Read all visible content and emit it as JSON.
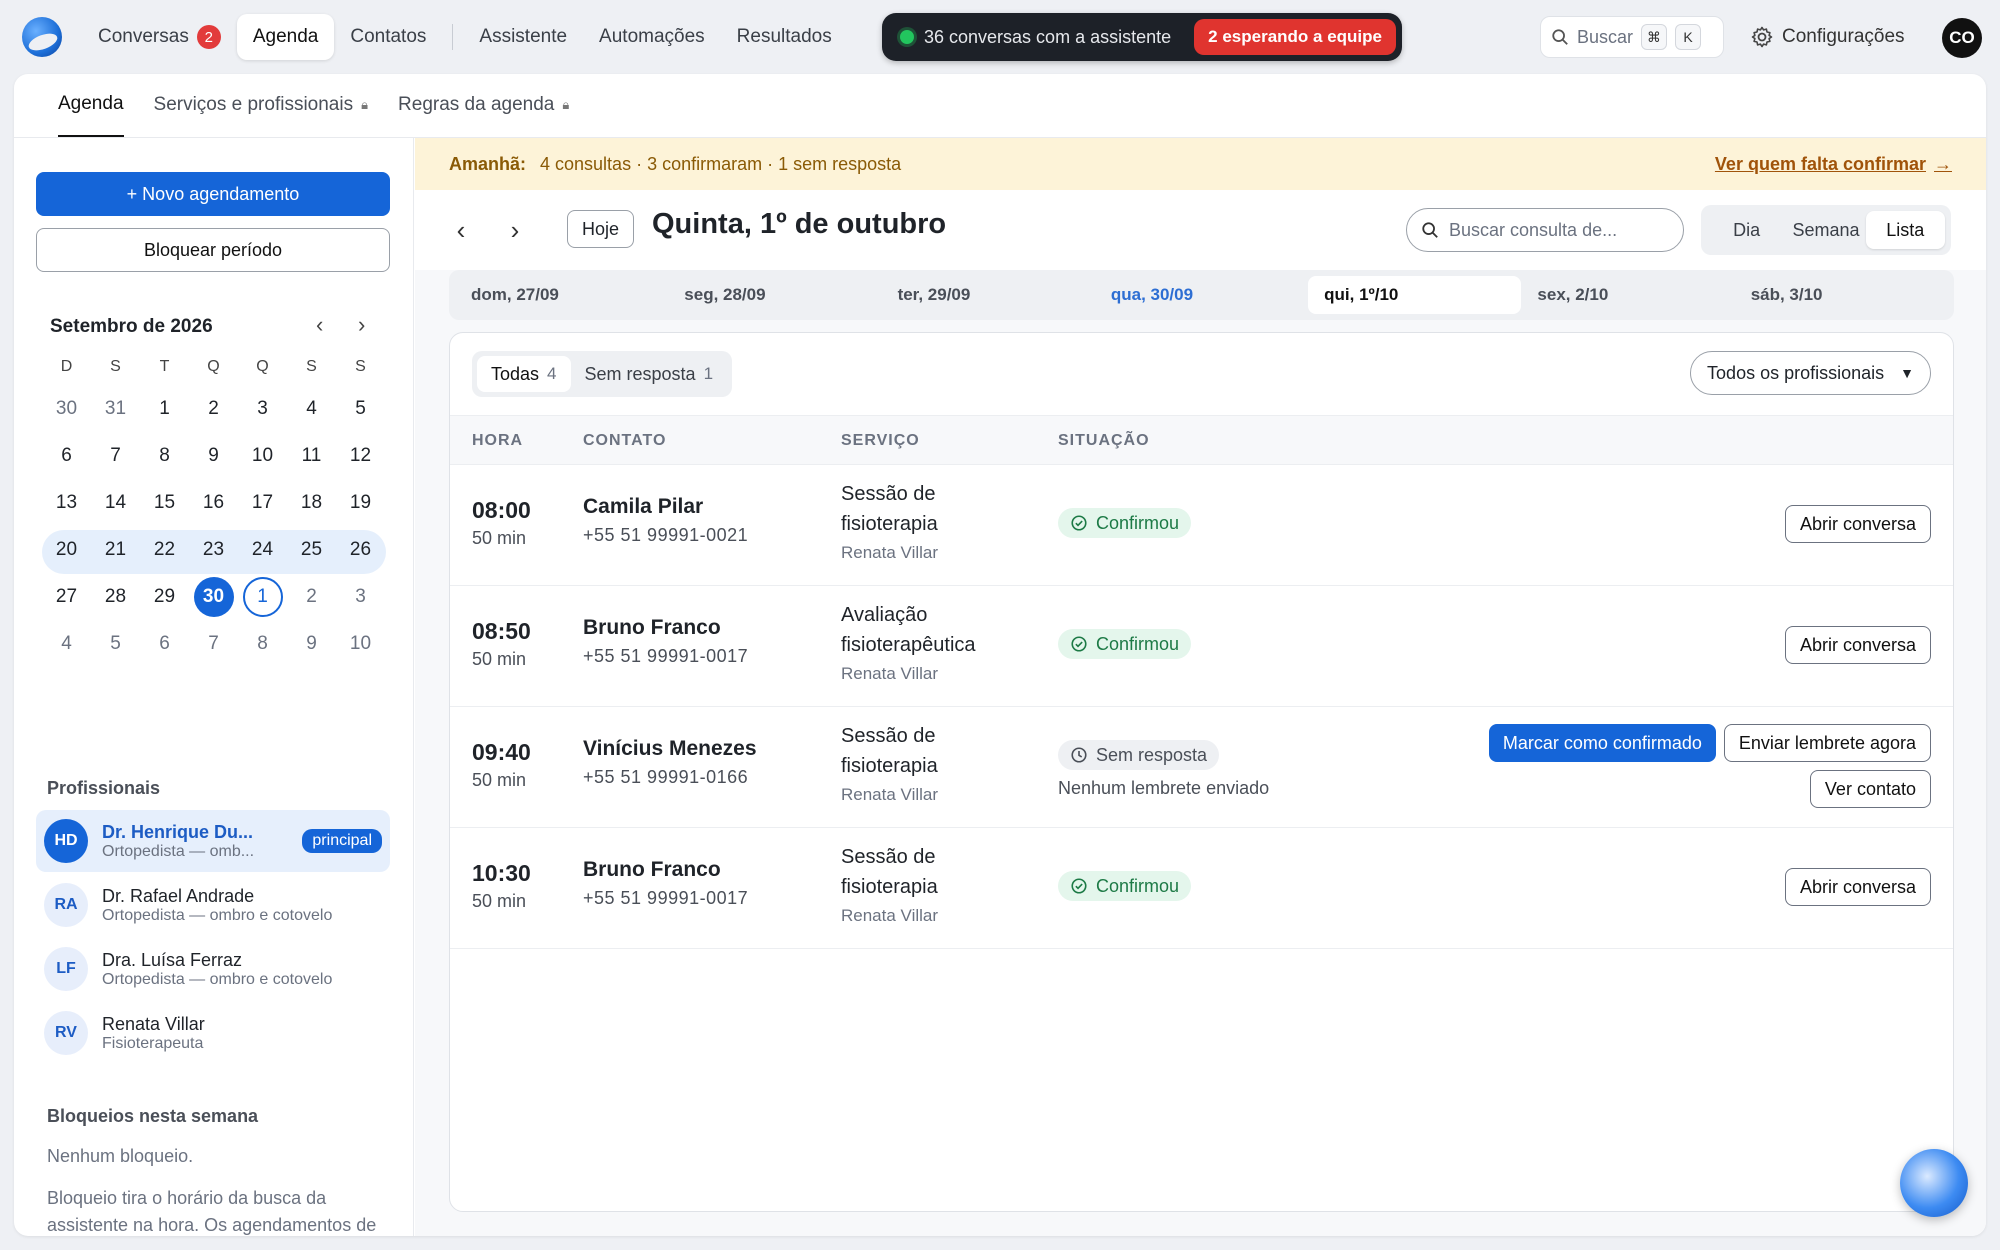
{
  "topnav": {
    "items": [
      {
        "label": "Conversas",
        "badge": "2"
      },
      {
        "label": "Agenda"
      },
      {
        "label": "Contatos"
      },
      {
        "label": "Assistente"
      },
      {
        "label": "Automações"
      },
      {
        "label": "Resultados"
      }
    ],
    "assistant_status": "36 conversas com a assistente",
    "waiting_team": "2 esperando a equipe",
    "search_label": "Buscar",
    "search_kbd": [
      "⌘",
      "K"
    ],
    "settings_label": "Configurações",
    "user_initials": "CO"
  },
  "subtabs": [
    {
      "label": "Agenda"
    },
    {
      "label": "Serviços e profissionais",
      "locked": true
    },
    {
      "label": "Regras da agenda",
      "locked": true
    }
  ],
  "sidebar": {
    "new_appointment": "+ Novo agendamento",
    "block_period": "Bloquear período",
    "calendar": {
      "title": "Setembro de 2026",
      "weekdays": [
        "D",
        "S",
        "T",
        "Q",
        "Q",
        "S",
        "S"
      ],
      "weeks": [
        [
          "30",
          "31",
          "1",
          "2",
          "3",
          "4",
          "5"
        ],
        [
          "6",
          "7",
          "8",
          "9",
          "10",
          "11",
          "12"
        ],
        [
          "13",
          "14",
          "15",
          "16",
          "17",
          "18",
          "19"
        ],
        [
          "20",
          "21",
          "22",
          "23",
          "24",
          "25",
          "26"
        ],
        [
          "27",
          "28",
          "29",
          "30",
          "1",
          "2",
          "3"
        ],
        [
          "4",
          "5",
          "6",
          "7",
          "8",
          "9",
          "10"
        ]
      ],
      "today": "30",
      "selected": "1"
    },
    "professionals_title": "Profissionais",
    "professionals": [
      {
        "initials": "HD",
        "name": "Dr. Henrique Du...",
        "role": "Ortopedista — omb...",
        "tag": "principal",
        "active": true
      },
      {
        "initials": "RA",
        "name": "Dr. Rafael Andrade",
        "role": "Ortopedista — ombro e cotovelo"
      },
      {
        "initials": "LF",
        "name": "Dra. Luísa Ferraz",
        "role": "Ortopedista — ombro e cotovelo"
      },
      {
        "initials": "RV",
        "name": "Renata Villar",
        "role": "Fisioterapeuta"
      }
    ],
    "blocks_title": "Bloqueios nesta semana",
    "blocks_none": "Nenhum bloqueio.",
    "blocks_note": "Bloqueio tira o horário da busca da assistente na hora. Os agendamentos de dentro do período continuam marcados: quem avisa é a empresa."
  },
  "banner": {
    "label": "Amanhã:",
    "text": "4 consultas · 3 confirmaram · 1 sem resposta",
    "link": "Ver quem falta confirmar",
    "link_arrow": "→"
  },
  "toolbar": {
    "today": "Hoje",
    "date_title": "Quinta, 1º de outubro",
    "search_placeholder": "Buscar consulta de...",
    "views": [
      "Dia",
      "Semana",
      "Lista"
    ],
    "active_view": "Lista"
  },
  "week": [
    "dom, 27/09",
    "seg, 28/09",
    "ter, 29/09",
    "qua, 30/09",
    "qui, 1º/10",
    "sex, 2/10",
    "sáb, 3/10"
  ],
  "list": {
    "filters": [
      {
        "label": "Todas",
        "count": "4"
      },
      {
        "label": "Sem resposta",
        "count": "1"
      }
    ],
    "professional_filter": "Todos os profissionais",
    "columns": [
      "HORA",
      "CONTATO",
      "SERVIÇO",
      "SITUAÇÃO"
    ],
    "rows": [
      {
        "time": "08:00",
        "duration": "50 min",
        "name": "Camila Pilar",
        "phone": "+55 51 99991-0021",
        "service": "Sessão de fisioterapia",
        "professional": "Renata Villar",
        "status": "Confirmou",
        "action": "Abrir conversa"
      },
      {
        "time": "08:50",
        "duration": "50 min",
        "name": "Bruno Franco",
        "phone": "+55 51 99991-0017",
        "service": "Avaliação fisioterapêutica",
        "professional": "Renata Villar",
        "status": "Confirmou",
        "action": "Abrir conversa"
      },
      {
        "time": "09:40",
        "duration": "50 min",
        "name": "Vinícius Menezes",
        "phone": "+55 51 99991-0166",
        "service": "Sessão de fisioterapia",
        "professional": "Renata Villar",
        "status": "Sem resposta",
        "status_note": "Nenhum lembrete enviado",
        "actions": [
          "Marcar como confirmado",
          "Enviar lembrete agora",
          "Ver contato"
        ]
      },
      {
        "time": "10:30",
        "duration": "50 min",
        "name": "Bruno Franco",
        "phone": "+55 51 99991-0017",
        "service": "Sessão de fisioterapia",
        "professional": "Renata Villar",
        "status": "Confirmou",
        "action": "Abrir conversa"
      }
    ]
  },
  "colors": {
    "accent": "#1565d8",
    "confirmed": "#1d7a46",
    "alert": "#e0342f",
    "banner_bg": "#fdf3d8"
  }
}
